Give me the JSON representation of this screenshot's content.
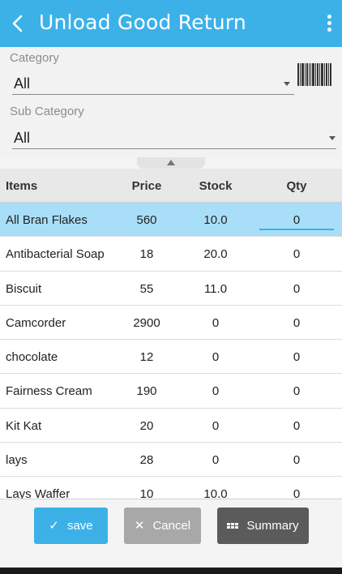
{
  "appbar": {
    "title": "Unload Good Return"
  },
  "filters": {
    "category_label": "Category",
    "category_value": "All",
    "subcategory_label": "Sub Category",
    "subcategory_value": "All"
  },
  "table": {
    "headers": {
      "items": "Items",
      "price": "Price",
      "stock": "Stock",
      "qty": "Qty"
    },
    "rows": [
      {
        "name": "All Bran Flakes",
        "price": "560",
        "stock": "10.0",
        "qty": "0"
      },
      {
        "name": "Antibacterial Soap",
        "price": "18",
        "stock": "20.0",
        "qty": "0"
      },
      {
        "name": "Biscuit",
        "price": "55",
        "stock": "11.0",
        "qty": "0"
      },
      {
        "name": "Camcorder",
        "price": "2900",
        "stock": "0",
        "qty": "0"
      },
      {
        "name": "chocolate",
        "price": "12",
        "stock": "0",
        "qty": "0"
      },
      {
        "name": "Fairness Cream",
        "price": "190",
        "stock": "0",
        "qty": "0"
      },
      {
        "name": "Kit Kat",
        "price": "20",
        "stock": "0",
        "qty": "0"
      },
      {
        "name": "lays",
        "price": "28",
        "stock": "0",
        "qty": "0"
      },
      {
        "name": "Lays Waffer",
        "price": "10",
        "stock": "10.0",
        "qty": "0"
      }
    ]
  },
  "footer": {
    "save_label": "save",
    "cancel_label": "Cancel",
    "summary_label": "Summary"
  },
  "colors": {
    "accent": "#3cb1e8",
    "selected_row": "#a9def8",
    "cancel": "#a8a8a8",
    "summary": "#5b5b5b"
  }
}
